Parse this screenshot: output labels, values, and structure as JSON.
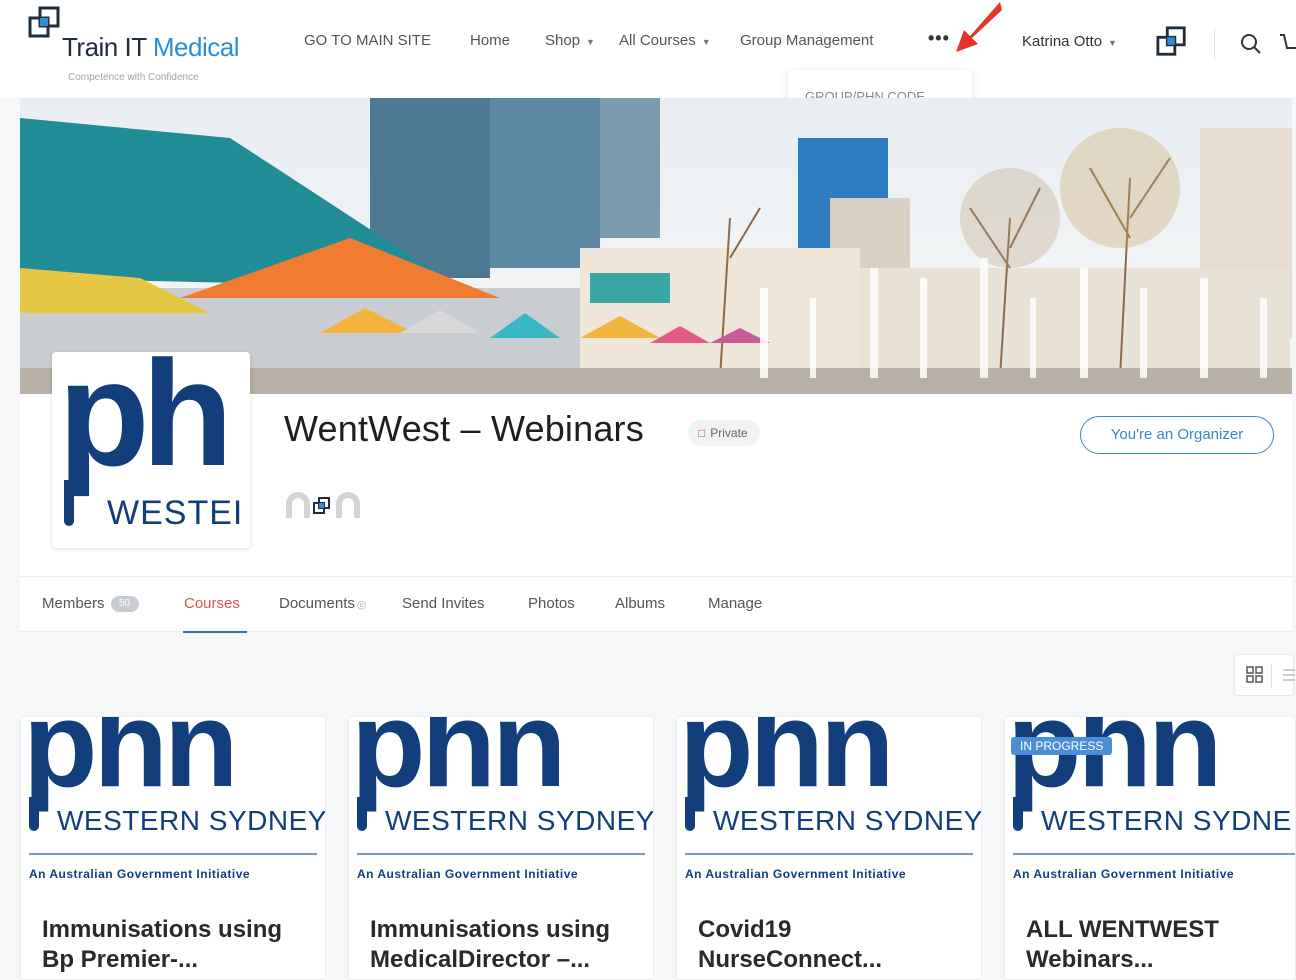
{
  "brand": {
    "name_part1": "Train IT",
    "name_part2": "Medical",
    "tagline": "Competence with Confidence"
  },
  "nav": {
    "items": [
      {
        "label": "GO TO MAIN SITE",
        "has_caret": false
      },
      {
        "label": "Home",
        "has_caret": false
      },
      {
        "label": "Shop",
        "has_caret": true
      },
      {
        "label": "All Courses",
        "has_caret": true
      },
      {
        "label": "Group Management",
        "has_caret": false
      }
    ],
    "more_label": "•••",
    "dropdown_item": "GROUP/PHN CODE",
    "user_name": "Katrina Otto"
  },
  "group": {
    "title": "WentWest – Webinars",
    "privacy": "Private",
    "organizer_button": "You're an Organizer",
    "avatar_big": "ph",
    "avatar_sub": "WESTEI"
  },
  "tabs": [
    {
      "label": "Members",
      "badge": "50",
      "active": false
    },
    {
      "label": "Courses",
      "active": true
    },
    {
      "label": "Documents",
      "active": false
    },
    {
      "label": "Send Invites",
      "active": false
    },
    {
      "label": "Photos",
      "active": false
    },
    {
      "label": "Albums",
      "active": false
    },
    {
      "label": "Manage",
      "active": false
    }
  ],
  "courses": [
    {
      "logo": "phn",
      "sub": "WESTERN SYDNEY",
      "gov": "An Australian Government Initiative",
      "title_line1": "Immunisations using",
      "title_line2": "Bp Premier-...",
      "badge": ""
    },
    {
      "logo": "phn",
      "sub": "WESTERN SYDNEY",
      "gov": "An Australian Government Initiative",
      "title_line1": "Immunisations using",
      "title_line2": "MedicalDirector –...",
      "badge": ""
    },
    {
      "logo": "phn",
      "sub": "WESTERN SYDNEY",
      "gov": "An Australian Government Initiative",
      "title_line1": "Covid19",
      "title_line2": "NurseConnect...",
      "badge": ""
    },
    {
      "logo": "phn",
      "sub": "WESTERN SYDNE",
      "gov": "An Australian Government Initiative",
      "title_line1": "ALL WENTWEST",
      "title_line2": "Webinars...",
      "badge": "IN PROGRESS"
    }
  ],
  "colors": {
    "accent": "#3a86d1",
    "active_tab": "#d9534f",
    "phn_navy": "#123e7c",
    "annotation_arrow": "#e8342f"
  }
}
